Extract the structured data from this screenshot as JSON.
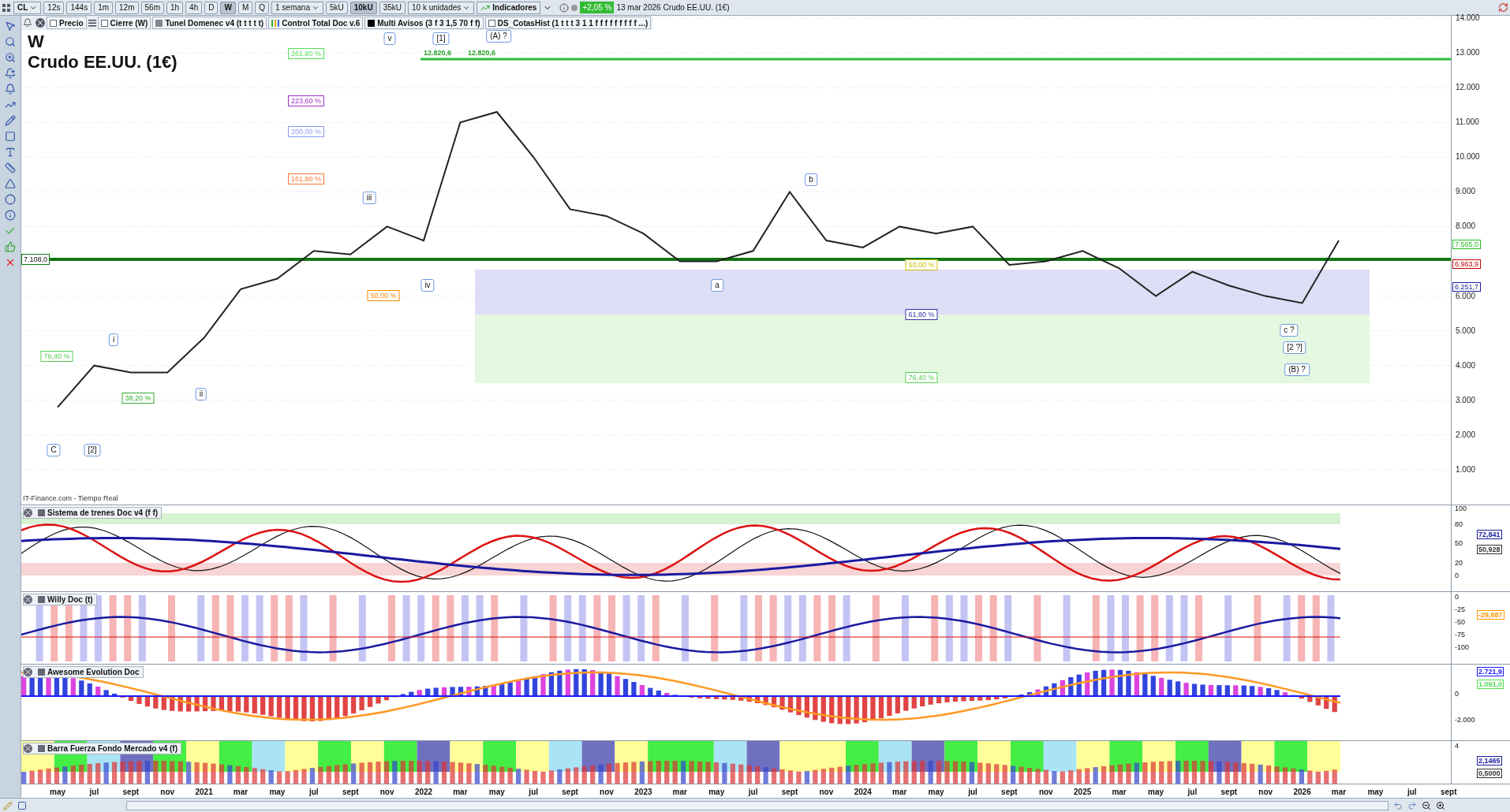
{
  "toolbar": {
    "symbol": "CL",
    "periods": [
      {
        "label": "12s",
        "selected": false
      },
      {
        "label": "144s",
        "selected": false
      },
      {
        "label": "1m",
        "selected": false
      },
      {
        "label": "12m",
        "selected": false
      },
      {
        "label": "56m",
        "selected": false
      },
      {
        "label": "1h",
        "selected": false
      },
      {
        "label": "4h",
        "selected": false
      },
      {
        "label": "D",
        "selected": false
      },
      {
        "label": "W",
        "selected": true
      },
      {
        "label": "M",
        "selected": false
      },
      {
        "label": "Q",
        "selected": false
      }
    ],
    "interval": "1 semana",
    "units": [
      {
        "label": "5kU",
        "selected": false
      },
      {
        "label": "10kU",
        "selected": true
      },
      {
        "label": "35kU",
        "selected": false
      }
    ],
    "unit_size": "10 k unidades",
    "indicators": "Indicadores",
    "change": "+2,05 %",
    "date": "13 mar 2026",
    "instrument": "Crudo EE.UU. (1€)"
  },
  "legend": [
    {
      "kind": "checkbox",
      "label": "Precio",
      "checked": false
    },
    {
      "kind": "checkbox",
      "label": "Cierre (W)",
      "checked": false
    },
    {
      "kind": "swatch",
      "label": "Tunel Domenec v4 (t t t t t)",
      "color": "#808890"
    },
    {
      "kind": "bars",
      "label": "Control Total Doc v.6"
    },
    {
      "kind": "swatch",
      "label": "Multi Avisos (3 f 3 1,5 70 f f)",
      "color": "#000000"
    },
    {
      "kind": "checkbox",
      "label": "DS_CotasHist (1 t t t 3 1 1 f f f f f f f f f ...)",
      "checked": false
    }
  ],
  "chart": {
    "timeframe": "W",
    "title": "Crudo EE.UU. (1€)",
    "source": "IT-Finance.com - Tiempo Real",
    "level_flag": "7.108,0",
    "high_labels": [
      "12.820,6",
      "12.820,6"
    ],
    "fib_levels": [
      "261,80 %",
      "223,60 %",
      "200,00 %",
      "161,80 %",
      "50,00 %",
      "50,00 %",
      "61,80 %",
      "76,40 %",
      "76,40 %",
      "38,20 %"
    ],
    "wave_labels": [
      "v",
      "[1]",
      "(A) ?",
      "iii",
      "iv",
      "i",
      "ii",
      "C",
      "[2]",
      "b",
      "a",
      "c ?",
      "[2 ?]",
      "(B) ?"
    ],
    "price_flags": [
      {
        "text": "7.565,0",
        "color": "#22c022"
      },
      {
        "text": "6.963,9",
        "color": "#c00000"
      },
      {
        "text": "6.251,7",
        "color": "#1a1aa0"
      }
    ],
    "time_axis": [
      "may",
      "jul",
      "sept",
      "nov",
      "2021",
      "mar",
      "may",
      "jul",
      "sept",
      "nov",
      "2022",
      "mar",
      "may",
      "jul",
      "sept",
      "nov",
      "2023",
      "mar",
      "may",
      "jul",
      "sept",
      "nov",
      "2024",
      "mar",
      "may",
      "jul",
      "sept",
      "nov",
      "2025",
      "mar",
      "may",
      "jul",
      "sept",
      "nov",
      "2026",
      "mar",
      "may",
      "jul",
      "sept"
    ],
    "chart_data": {
      "type": "line",
      "grid": true,
      "ylim": [
        0,
        14068
      ],
      "values": [
        2800,
        4000,
        3800,
        3800,
        4800,
        6200,
        6500,
        7300,
        7200,
        8000,
        7600,
        11000,
        11300,
        10000,
        8500,
        8300,
        7800,
        7000,
        7000,
        7300,
        9000,
        7600,
        7400,
        8000,
        7800,
        8000,
        6900,
        7000,
        7300,
        6800,
        6000,
        6700,
        6300,
        6000,
        5800,
        7600,
        null,
        null,
        null
      ],
      "yticks": [
        {
          "value": 1000,
          "label": "1.000"
        },
        {
          "value": 2000,
          "label": "2.000"
        },
        {
          "value": 3000,
          "label": "3.000"
        },
        {
          "value": 4000,
          "label": "4.000"
        },
        {
          "value": 5000,
          "label": "5.000"
        },
        {
          "value": 6000,
          "label": "6.000"
        },
        {
          "value": 8000,
          "label": "8.000"
        },
        {
          "value": 9000,
          "label": "9.000"
        },
        {
          "value": 10000,
          "label": "10.000"
        },
        {
          "value": 11000,
          "label": "11.000"
        },
        {
          "value": 12000,
          "label": "12.000"
        },
        {
          "value": 13000,
          "label": "13.000"
        },
        {
          "value": 14000,
          "label": "14.000"
        }
      ]
    }
  },
  "panes": [
    {
      "kind": "trains",
      "title": "Sistema de trenes Doc v4 (f f)",
      "ticks": [
        "100",
        "80",
        "50",
        "20",
        "0"
      ],
      "flags": [
        {
          "text": "72,841",
          "color": "#1a1aa0"
        },
        {
          "text": "50,928",
          "color": "#333333"
        }
      ]
    },
    {
      "kind": "willy",
      "title": "Willy Doc (t)",
      "ticks": [
        "0",
        "-25",
        "-50",
        "-75",
        "-100"
      ],
      "flags": [
        {
          "text": "-29,687",
          "color": "#ff9900"
        }
      ]
    },
    {
      "kind": "awesome",
      "title": "Awesome Evolution Doc",
      "ticks": [
        "0",
        "-2.000"
      ],
      "flags": [
        {
          "text": "2.721,9",
          "color": "#1a1aff"
        },
        {
          "text": "1.091,0",
          "color": "#55dd55"
        }
      ]
    },
    {
      "kind": "force",
      "title": "Barra Fuerza Fondo Mercado v4 (f)",
      "ticks": [
        "4"
      ],
      "flags": [
        {
          "text": "2,1465",
          "color": "#1a1aa0"
        },
        {
          "text": "0,5000",
          "color": "#333333"
        }
      ]
    }
  ]
}
